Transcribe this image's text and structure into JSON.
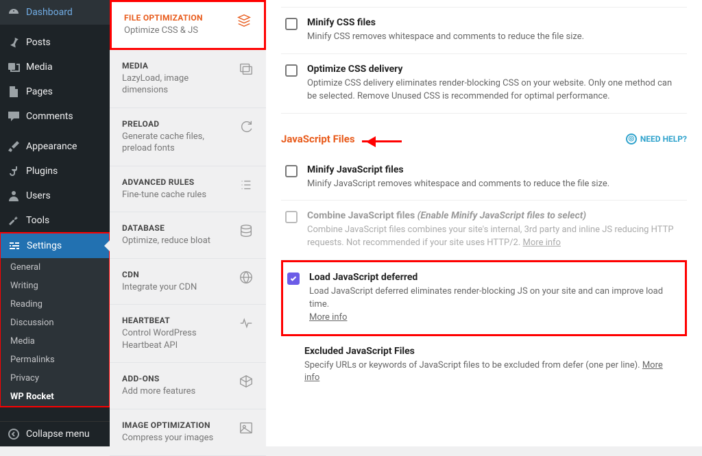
{
  "wpMenu": {
    "dashboard": "Dashboard",
    "posts": "Posts",
    "media": "Media",
    "pages": "Pages",
    "comments": "Comments",
    "appearance": "Appearance",
    "plugins": "Plugins",
    "users": "Users",
    "tools": "Tools",
    "settings": "Settings",
    "collapse": "Collapse menu"
  },
  "wpSubmenu": {
    "general": "General",
    "writing": "Writing",
    "reading": "Reading",
    "discussion": "Discussion",
    "media": "Media",
    "permalinks": "Permalinks",
    "privacy": "Privacy",
    "wprocket": "WP Rocket"
  },
  "tabs": {
    "fileopt": {
      "title": "FILE OPTIMIZATION",
      "desc": "Optimize CSS & JS"
    },
    "media": {
      "title": "MEDIA",
      "desc": "LazyLoad, image dimensions"
    },
    "preload": {
      "title": "PRELOAD",
      "desc": "Generate cache files, preload fonts"
    },
    "advanced": {
      "title": "ADVANCED RULES",
      "desc": "Fine-tune cache rules"
    },
    "database": {
      "title": "DATABASE",
      "desc": "Optimize, reduce bloat"
    },
    "cdn": {
      "title": "CDN",
      "desc": "Integrate your CDN"
    },
    "heartbeat": {
      "title": "HEARTBEAT",
      "desc": "Control WordPress Heartbeat API"
    },
    "addons": {
      "title": "ADD-ONS",
      "desc": "Add more features"
    },
    "imgopt": {
      "title": "IMAGE OPTIMIZATION",
      "desc": "Compress your images"
    }
  },
  "content": {
    "needHelp": "NEED HELP?",
    "jsSection": "JavaScript Files",
    "moreInfo": "More info",
    "options": {
      "minifyCss": {
        "title": "Minify CSS files",
        "desc": "Minify CSS removes whitespace and comments to reduce the file size."
      },
      "optimizeCss": {
        "title": "Optimize CSS delivery",
        "desc": "Optimize CSS delivery eliminates render-blocking CSS on your website. Only one method can be selected. Remove Unused CSS is recommended for optimal performance."
      },
      "minifyJs": {
        "title": "Minify JavaScript files",
        "desc": "Minify JavaScript removes whitespace and comments to reduce the file size."
      },
      "combineJs": {
        "title": "Combine JavaScript files",
        "suffix": "(Enable Minify JavaScript files to select)",
        "desc": "Combine JavaScript files combines your site's internal, 3rd party and inline JS reducing HTTP requests. Not recommended if your site uses HTTP/2."
      },
      "deferJs": {
        "title": "Load JavaScript deferred",
        "desc": "Load JavaScript deferred eliminates render-blocking JS on your site and can improve load time."
      },
      "excludeJs": {
        "title": "Excluded JavaScript Files",
        "desc": "Specify URLs or keywords of JavaScript files to be excluded from defer (one per line)."
      }
    }
  }
}
